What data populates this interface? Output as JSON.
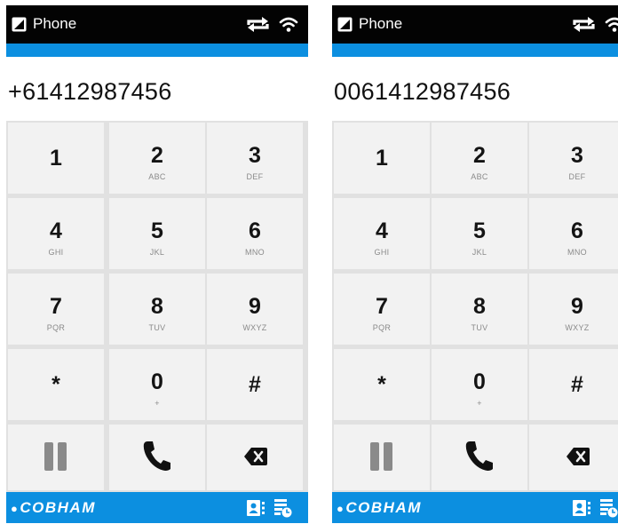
{
  "screens": [
    {
      "app_title": "Phone",
      "dialed_number": "+61412987456",
      "keys": [
        {
          "digit": "1",
          "letters": ""
        },
        {
          "digit": "2",
          "letters": "ABC"
        },
        {
          "digit": "3",
          "letters": "DEF"
        },
        {
          "digit": "4",
          "letters": "GHI"
        },
        {
          "digit": "5",
          "letters": "JKL"
        },
        {
          "digit": "6",
          "letters": "MNO"
        },
        {
          "digit": "7",
          "letters": "PQR"
        },
        {
          "digit": "8",
          "letters": "TUV"
        },
        {
          "digit": "9",
          "letters": "WXYZ"
        },
        {
          "digit": "*",
          "letters": ""
        },
        {
          "digit": "0",
          "letters": "+"
        },
        {
          "digit": "#",
          "letters": ""
        }
      ],
      "actions": {
        "pause_icon": "pause-icon",
        "call_icon": "phone-call-icon",
        "delete_icon": "backspace-icon"
      },
      "brand": "COBHAM"
    },
    {
      "app_title": "Phone",
      "dialed_number": "0061412987456",
      "keys": [
        {
          "digit": "1",
          "letters": ""
        },
        {
          "digit": "2",
          "letters": "ABC"
        },
        {
          "digit": "3",
          "letters": "DEF"
        },
        {
          "digit": "4",
          "letters": "GHI"
        },
        {
          "digit": "5",
          "letters": "JKL"
        },
        {
          "digit": "6",
          "letters": "MNO"
        },
        {
          "digit": "7",
          "letters": "PQR"
        },
        {
          "digit": "8",
          "letters": "TUV"
        },
        {
          "digit": "9",
          "letters": "WXYZ"
        },
        {
          "digit": "*",
          "letters": ""
        },
        {
          "digit": "0",
          "letters": "+"
        },
        {
          "digit": "#",
          "letters": ""
        }
      ],
      "actions": {
        "pause_icon": "pause-icon",
        "call_icon": "phone-call-icon",
        "delete_icon": "backspace-icon"
      },
      "brand": "COBHAM"
    }
  ],
  "colors": {
    "status_bar": "#030303",
    "accent": "#0C8FE0",
    "key_background": "#f2f2f2",
    "keypad_gap": "#e1e1e1",
    "text": "#141414"
  }
}
